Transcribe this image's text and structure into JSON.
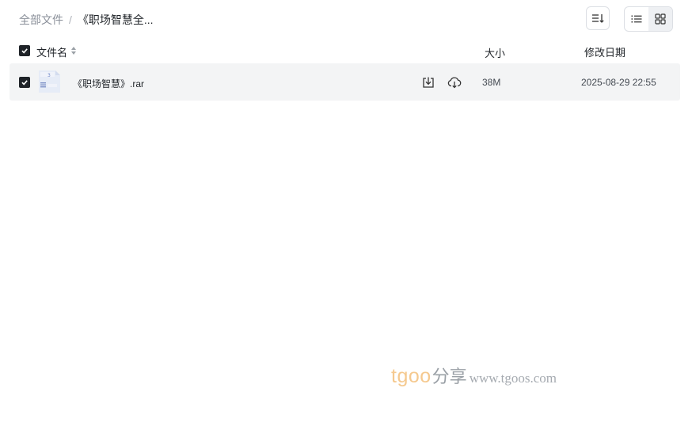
{
  "breadcrumb": {
    "root": "全部文件",
    "separator": "/",
    "current": "《职场智慧全..."
  },
  "toolbar": {
    "sort_icon": "sort-lines-icon",
    "list_icon": "list-view-icon",
    "grid_icon": "grid-view-icon",
    "active_view": "list"
  },
  "table": {
    "headers": {
      "name": "文件名",
      "size": "大小",
      "date": "修改日期"
    },
    "select_all": true,
    "rows": [
      {
        "selected": true,
        "icon": "archive-file-icon",
        "name": "《职场智慧》.rar",
        "size": "38M",
        "date": "2025-08-29 22:55"
      }
    ]
  },
  "watermark": {
    "brand": "tgoo",
    "cn": "分享",
    "url": "www.tgoos.com"
  },
  "colors": {
    "checkbox": "#1f2328",
    "row_bg": "#f3f4f5",
    "watermark_brand": "#f5c98f"
  }
}
